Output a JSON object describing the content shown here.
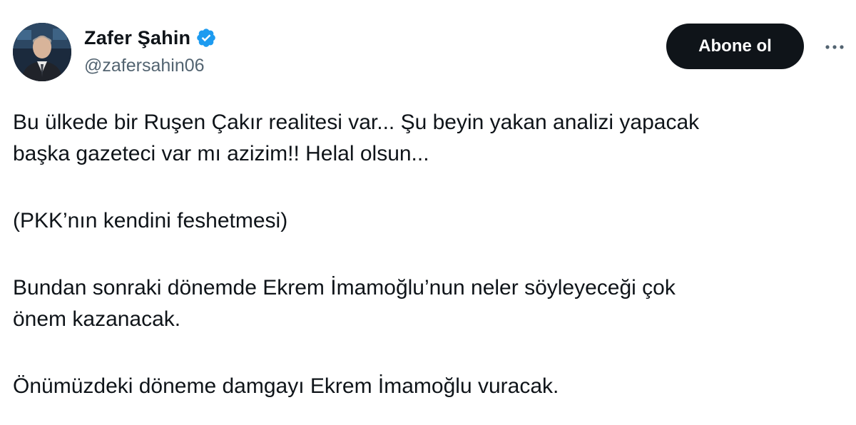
{
  "author": {
    "display_name": "Zafer Şahin",
    "handle": "@zafersahin06",
    "verified": true,
    "avatar_icon": "profile-photo",
    "verified_icon": "verified-badge-icon",
    "verified_color": "#1d9bf0"
  },
  "actions": {
    "follow_label": "Abone ol",
    "more_icon": "more-horizontal-icon"
  },
  "tweet": {
    "paragraphs": [
      {
        "lines": [
          "Bu ülkede bir Ruşen Çakır realitesi var... Şu beyin yakan analizi yapacak",
          "başka gazeteci var mı azizim!! Helal olsun..."
        ]
      },
      {
        "lines": [
          "(PKK’nın kendini feshetmesi)"
        ]
      },
      {
        "lines": [
          "Bundan sonraki dönemde Ekrem İmamoğlu’nun neler söyleyeceği çok",
          "önem kazanacak."
        ]
      },
      {
        "lines": [
          "Önümüzdeki döneme damgayı Ekrem İmamoğlu vuracak."
        ]
      }
    ]
  },
  "colors": {
    "text_primary": "#0f1419",
    "text_secondary": "#536471",
    "button_bg": "#0f1419",
    "button_text": "#ffffff"
  }
}
